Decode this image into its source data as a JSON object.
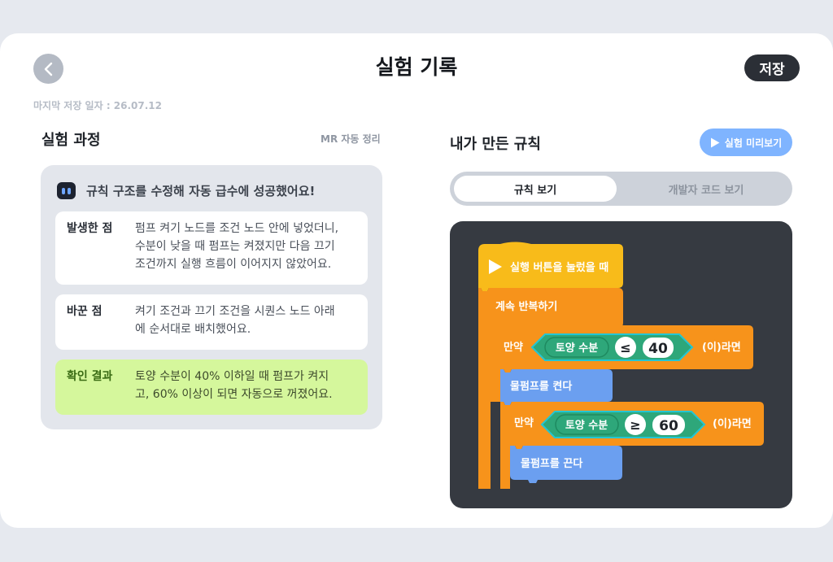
{
  "header": {
    "title": "실험 기록",
    "save_label": "저장",
    "last_saved": "마지막 저장 일자 : 26.07.12"
  },
  "left": {
    "section_title": "실험 과정",
    "mr_label": "MR 자동 정리",
    "summary": "규칙 구조를 수정해 자동 급수에 성공했어요!",
    "cards": [
      {
        "label": "발생한 점",
        "text": "펌프 켜기 노드를 조건 노드 안에 넣었더니,\n수분이 낮을 때 펌프는 켜졌지만 다음 끄기\n조건까지 실행 흐름이 이어지지 않았어요."
      },
      {
        "label": "바꾼 점",
        "text": "켜기 조건과 끄기 조건을 시퀀스 노드 아래\n에 순서대로 배치했어요."
      },
      {
        "label": "확인 결과",
        "text": "토양 수분이 40% 이하일 때 펌프가 켜지\n고, 60% 이상이 되면 자동으로 꺼졌어요."
      }
    ]
  },
  "right": {
    "section_title": "내가 만든 규칙",
    "preview_label": "실험 미리보기",
    "tabs": [
      "규칙 보기",
      "개발자 코드 보기"
    ],
    "blocks": {
      "start": "실행 버튼을 눌렀을 때",
      "loop": "계속 반복하기",
      "if1": {
        "prefix": "만약",
        "sensor": "토양 수분",
        "op": "≤",
        "value": "40",
        "suffix": "(이)라면"
      },
      "action1": "물펌프를 켠다",
      "if2": {
        "prefix": "만약",
        "sensor": "토양 수분",
        "op": "≥",
        "value": "60",
        "suffix": "(이)라면"
      },
      "action2": "물펌프를 끈다"
    }
  },
  "colors": {
    "event": "#f8bb1a",
    "control": "#f7931b",
    "sensor": "#2ea77a",
    "action": "#6b9ff0",
    "panel_dark": "#363a41",
    "accent": "#7fb4ff"
  }
}
